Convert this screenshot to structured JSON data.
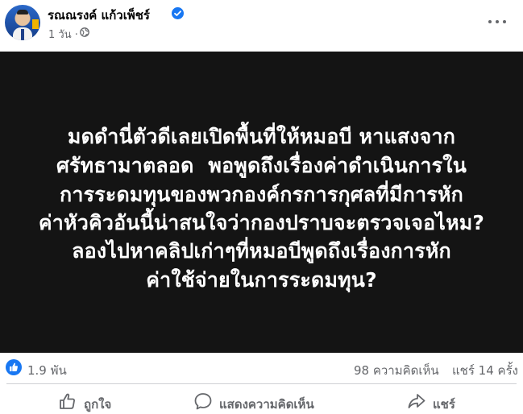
{
  "post": {
    "author": "รณณรงค์ แก้วเพ็ชร์",
    "time": "1 วัน ·",
    "lines": [
      "มดดำนี่ตัวดีเลยเปิดพื้นที่ให้หมอบี หาแสงจาก",
      "ศรัทธามาตลอด ￼ พอพูดถึงเรื่องค่าดำเนินการใน",
      "การระดมทุนของพวกองค์กรการกุศลที่มีการหัก",
      "ค่าหัวคิวอันนี้น่าสนใจว่ากองปราบจะตรวจเจอไหม?",
      "ลองไปหาคลิปเก่าๆ￼ที่หมอบีพูดถึงเรื่องการหัก",
      "ค่าใช้จ่ายในการระดมทุน?￼"
    ]
  },
  "stats": {
    "likes": "1.9 พัน",
    "comments": "98 ความคิดเห็น",
    "shares": "แชร์ 14 ครั้ง"
  },
  "actions": {
    "like": "ถูกใจ",
    "comment": "แสดงความคิดเห็น",
    "share": "แชร์"
  },
  "icons": {
    "verified": "verified-badge-icon",
    "privacy": "globe-icon",
    "more": "more-options-icon",
    "like_reaction": "like-reaction-icon"
  },
  "colors": {
    "accent": "#1877f2",
    "muted_text": "#65676b",
    "media_bg": "#141414"
  }
}
